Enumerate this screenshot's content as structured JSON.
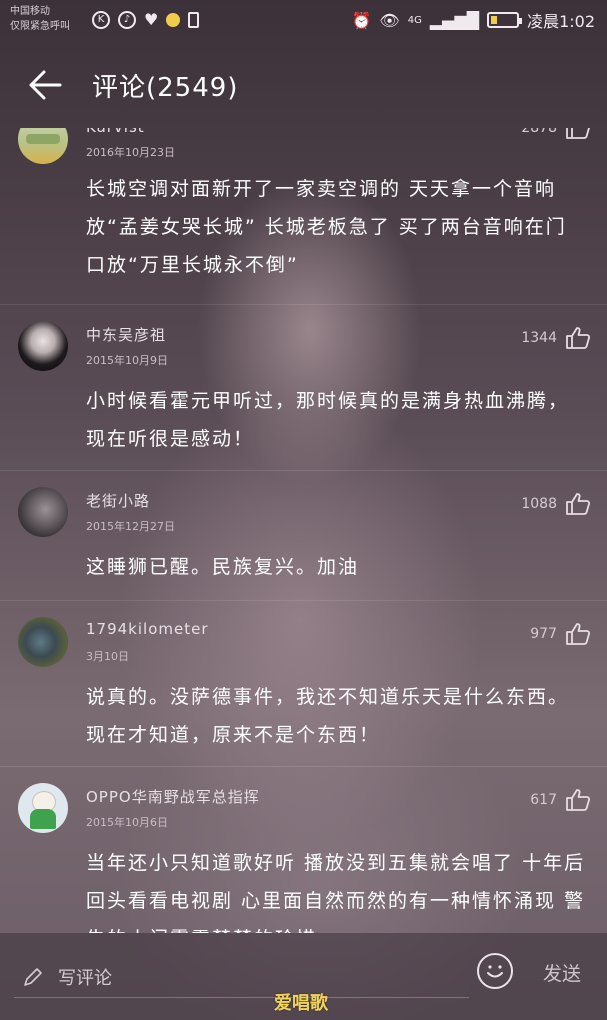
{
  "statusbar": {
    "carrier_line1": "中国移动",
    "carrier_line2": "仅限紧急呼叫",
    "left_icons": [
      "k-icon",
      "netease-music-icon",
      "heart-rate-icon",
      "notification-dot-icon",
      "sim-icon"
    ],
    "right_icons": [
      "alarm-icon",
      "eye-icon",
      "4g-signal-icon",
      "signal-bars-icon",
      "battery-icon"
    ],
    "time": "凌晨1:02",
    "battery_level": 0.25,
    "battery_color": "#f1cc4a"
  },
  "header": {
    "back_icon": "arrow-left-icon",
    "title": "评论(2549)"
  },
  "comments": [
    {
      "user": "Karvist",
      "date": "2016年10月23日",
      "likes": "2878",
      "text": "长城空调对面新开了一家卖空调的 天天拿一个音响放“孟姜女哭长城” 长城老板急了 买了两台音响在门口放“万里长城永不倒”"
    },
    {
      "user": "中东吴彦祖",
      "date": "2015年10月9日",
      "likes": "1344",
      "text": "小时候看霍元甲听过，那时候真的是满身热血沸腾，现在听很是感动！"
    },
    {
      "user": "老街小路",
      "date": "2015年12月27日",
      "likes": "1088",
      "text": "这睡狮已醒。民族复兴。加油"
    },
    {
      "user": "1794kilometer",
      "date": "3月10日",
      "likes": "977",
      "text": "说真的。没萨德事件，我还不知道乐天是什么东西。现在才知道，原来不是个东西！"
    },
    {
      "user": "OPPO华南野战军总指挥",
      "date": "2015年10月6日",
      "likes": "617",
      "text": "当年还小只知道歌好听  播放没到五集就会唱了  十年后回头看看电视剧  心里面自然而然的有一种情怀涌现  警告的小门霓霞楚楚的珍惜"
    }
  ],
  "inputbar": {
    "placeholder": "写评论",
    "send_label": "发送"
  },
  "watermark": "爱唱歌"
}
